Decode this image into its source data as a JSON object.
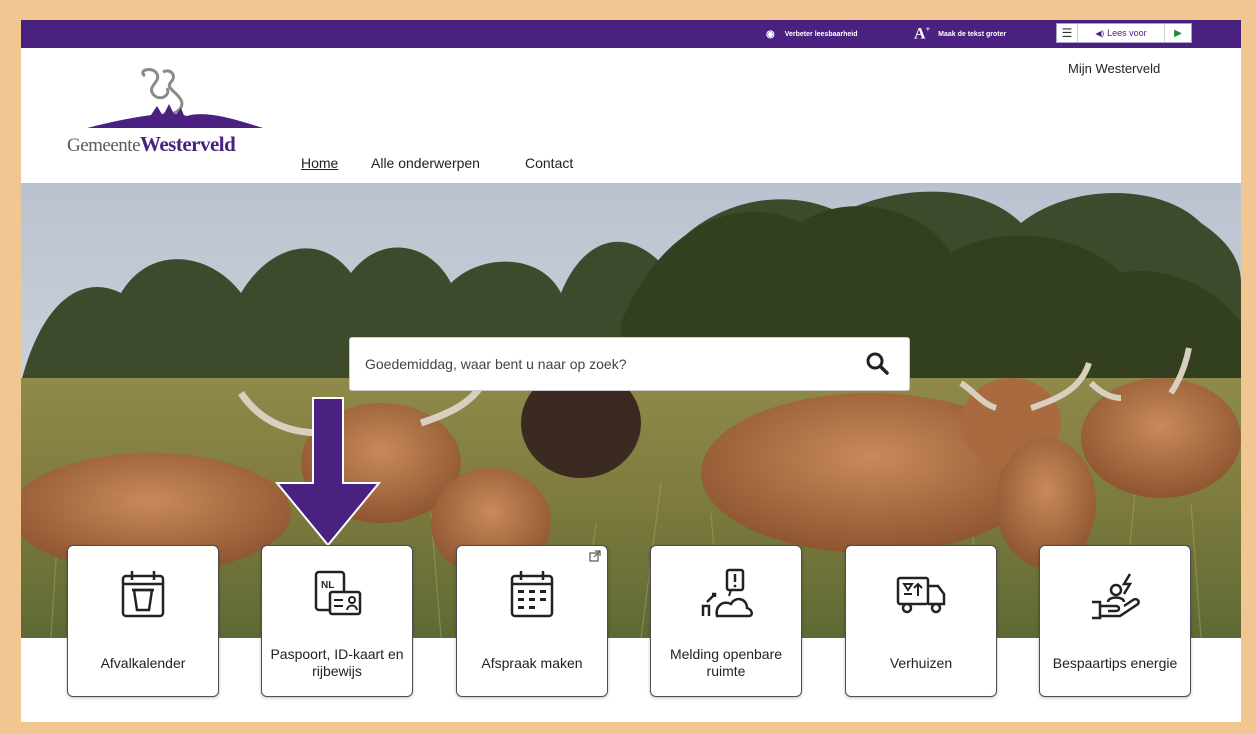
{
  "topbar": {
    "readability_label": "Verbeter leesbaarheid",
    "readability_icon": "eye-icon",
    "textsize_label": "Maak de tekst groter",
    "textsize_icon": "font-size-icon",
    "read_aloud_label": "Lees voor",
    "menu_icon": "menu-icon",
    "speaker_icon": "speaker-icon",
    "play_icon": "play-icon"
  },
  "header": {
    "logo_prefix": "Gemeente",
    "logo_name": "Westerveld",
    "nav": {
      "home": "Home",
      "all_topics": "Alle onderwerpen",
      "contact": "Contact"
    },
    "my_link": "Mijn Westerveld"
  },
  "search": {
    "placeholder": "Goedemiddag, waar bent u naar op zoek?",
    "icon": "search-icon"
  },
  "tiles": [
    {
      "label": "Afvalkalender",
      "icon": "waste-calendar-icon"
    },
    {
      "label": "Paspoort, ID-kaart en rijbewijs",
      "icon": "id-card-icon",
      "badge": "NL"
    },
    {
      "label": "Afspraak maken",
      "icon": "calendar-icon",
      "external": true
    },
    {
      "label": "Melding openbare ruimte",
      "icon": "public-space-report-icon"
    },
    {
      "label": "Verhuizen",
      "icon": "moving-truck-icon"
    },
    {
      "label": "Bespaartips energie",
      "icon": "energy-saving-icon"
    }
  ],
  "colors": {
    "brand_purple": "#4a2180",
    "frame_border": "#f2c691"
  }
}
